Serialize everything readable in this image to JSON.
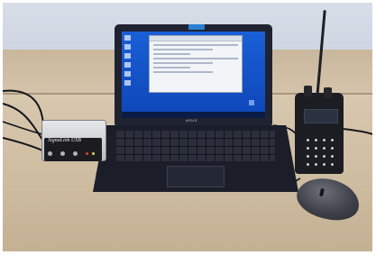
{
  "photo": {
    "description_tag": "natural-image",
    "signalink_label": "SignaLink USB",
    "laptop_brand": "ASUS"
  }
}
